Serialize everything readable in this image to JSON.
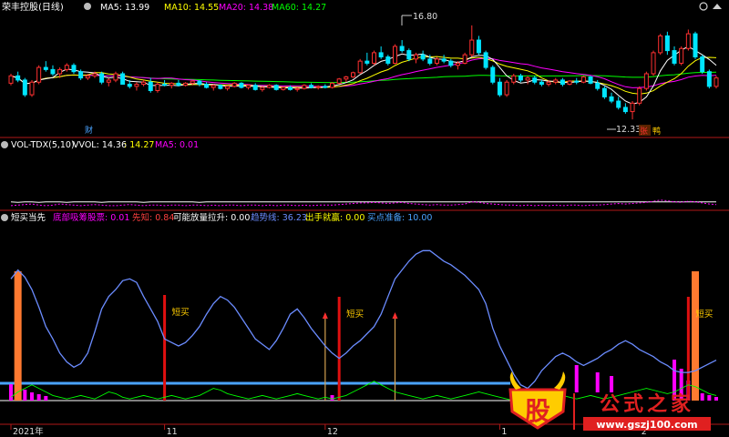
{
  "header": {
    "stock_title": "荣丰控股(日线)",
    "ma_items": [
      {
        "label": "MA5: 13.99",
        "color": "#ffffff"
      },
      {
        "label": "MA10: 14.55",
        "color": "#ffff00"
      },
      {
        "label": "MA20: 14.38",
        "color": "#ff00ff"
      },
      {
        "label": "MA60: 14.27",
        "color": "#00ff00"
      }
    ]
  },
  "price_annotations": {
    "high": "16.80",
    "low": "12.33",
    "cai_marker": "财",
    "zhang_marker": "张",
    "xiu_marker": "鸭"
  },
  "vol_header": {
    "title": "VOL-TDX(5,10)",
    "vvol": "VVOL: 14.36",
    "vvol2": ": 14.27",
    "ma5": "MA5: 0.01"
  },
  "ind_header": {
    "title": "短买当先",
    "items": [
      {
        "label": "底部吸筹股票: 0.01",
        "color": "#ff00ff"
      },
      {
        "label": "先知: 0.84",
        "color": "#ff4040"
      },
      {
        "label": "可能放量拉升: 0.00",
        "color": "#ffffff"
      },
      {
        "label": "趋势线: 36.23",
        "color": "#6b8cff"
      },
      {
        "label": "出手就赢: 0.00",
        "color": "#ffff00"
      },
      {
        "label": "买点准备: 10.00",
        "color": "#4aa3ff"
      }
    ]
  },
  "signal_label": "短买",
  "x_axis": {
    "labels": [
      {
        "text": "2021年",
        "i": 0
      },
      {
        "text": "11",
        "i": 22
      },
      {
        "text": "12",
        "i": 45
      },
      {
        "text": "1",
        "i": 70
      },
      {
        "text": "2",
        "i": 90
      }
    ]
  },
  "watermark": {
    "seal": "股",
    "name": "公式之家",
    "url": "www.gszj100.com"
  },
  "colors": {
    "up": "#ff3030",
    "down": "#00e5ff",
    "ma5": "#ffffff",
    "ma10": "#ffff00",
    "ma20": "#ff00ff",
    "ma60": "#00ff00",
    "trend": "#6b8cff"
  },
  "chart_data": [
    {
      "type": "candlestick",
      "name": "price",
      "ylim": [
        11.6,
        17.4
      ],
      "ohlc": [
        [
          14.05,
          14.5,
          13.95,
          14.4
        ],
        [
          14.4,
          14.6,
          14.1,
          14.2
        ],
        [
          14.2,
          14.3,
          13.4,
          13.5
        ],
        [
          13.5,
          14.2,
          13.4,
          14.1
        ],
        [
          14.1,
          14.9,
          14.0,
          14.8
        ],
        [
          14.8,
          15.1,
          14.6,
          14.7
        ],
        [
          14.7,
          14.9,
          14.4,
          14.5
        ],
        [
          14.5,
          14.8,
          14.3,
          14.7
        ],
        [
          14.7,
          15.0,
          14.6,
          14.9
        ],
        [
          14.9,
          15.0,
          14.5,
          14.6
        ],
        [
          14.6,
          14.7,
          14.2,
          14.3
        ],
        [
          14.3,
          14.5,
          14.2,
          14.4
        ],
        [
          14.4,
          14.6,
          14.3,
          14.5
        ],
        [
          14.5,
          14.6,
          14.0,
          14.1
        ],
        [
          14.1,
          14.3,
          13.9,
          14.2
        ],
        [
          14.2,
          14.6,
          14.1,
          14.5
        ],
        [
          14.5,
          14.6,
          14.0,
          14.0
        ],
        [
          14.0,
          14.2,
          13.8,
          13.9
        ],
        [
          13.9,
          14.1,
          13.7,
          14.0
        ],
        [
          14.0,
          14.2,
          13.9,
          14.1
        ],
        [
          14.1,
          14.3,
          13.6,
          13.7
        ],
        [
          13.7,
          14.1,
          13.6,
          14.0
        ],
        [
          14.0,
          14.2,
          13.9,
          13.95
        ],
        [
          13.95,
          14.1,
          13.8,
          14.05
        ],
        [
          14.05,
          14.2,
          13.9,
          13.95
        ],
        [
          13.95,
          14.1,
          13.9,
          14.05
        ],
        [
          14.05,
          14.2,
          13.95,
          14.15
        ],
        [
          14.15,
          14.2,
          13.9,
          14.0
        ],
        [
          14.0,
          14.1,
          13.8,
          13.85
        ],
        [
          13.85,
          14.0,
          13.7,
          13.95
        ],
        [
          13.95,
          14.0,
          13.75,
          13.8
        ],
        [
          13.8,
          13.95,
          13.7,
          13.9
        ],
        [
          13.9,
          14.1,
          13.85,
          14.05
        ],
        [
          14.05,
          14.1,
          13.8,
          13.85
        ],
        [
          13.85,
          14.0,
          13.75,
          13.95
        ],
        [
          13.95,
          14.05,
          13.7,
          13.75
        ],
        [
          13.75,
          13.9,
          13.65,
          13.85
        ],
        [
          13.85,
          14.0,
          13.8,
          13.95
        ],
        [
          13.95,
          14.0,
          13.7,
          13.75
        ],
        [
          13.75,
          13.9,
          13.7,
          13.85
        ],
        [
          13.85,
          13.95,
          13.7,
          13.75
        ],
        [
          13.75,
          13.85,
          13.65,
          13.8
        ],
        [
          13.8,
          14.0,
          13.75,
          13.95
        ],
        [
          13.95,
          14.05,
          13.8,
          13.85
        ],
        [
          13.85,
          13.95,
          13.75,
          13.9
        ],
        [
          13.9,
          14.0,
          13.8,
          13.85
        ],
        [
          13.85,
          14.1,
          13.8,
          14.05
        ],
        [
          14.05,
          14.3,
          14.0,
          14.25
        ],
        [
          14.25,
          14.4,
          14.1,
          14.35
        ],
        [
          14.35,
          14.6,
          14.3,
          14.55
        ],
        [
          14.55,
          15.2,
          14.5,
          15.1
        ],
        [
          15.1,
          15.5,
          14.9,
          15.0
        ],
        [
          15.0,
          15.6,
          14.9,
          15.5
        ],
        [
          15.5,
          15.8,
          15.2,
          15.3
        ],
        [
          15.3,
          15.4,
          14.9,
          15.0
        ],
        [
          15.0,
          15.9,
          14.95,
          15.8
        ],
        [
          15.8,
          16.1,
          15.5,
          15.6
        ],
        [
          15.6,
          15.7,
          15.1,
          15.2
        ],
        [
          15.2,
          15.5,
          15.0,
          15.4
        ],
        [
          15.4,
          15.6,
          15.1,
          15.2
        ],
        [
          15.2,
          15.4,
          14.9,
          15.0
        ],
        [
          15.0,
          15.3,
          14.9,
          15.2
        ],
        [
          15.2,
          15.4,
          15.0,
          15.1
        ],
        [
          15.1,
          15.2,
          14.8,
          14.9
        ],
        [
          14.9,
          15.1,
          14.7,
          15.0
        ],
        [
          15.0,
          15.5,
          14.95,
          15.4
        ],
        [
          15.4,
          16.8,
          15.3,
          16.1
        ],
        [
          16.1,
          16.3,
          15.4,
          15.5
        ],
        [
          15.5,
          15.6,
          14.7,
          14.8
        ],
        [
          14.8,
          14.9,
          14.0,
          14.1
        ],
        [
          14.1,
          14.3,
          13.4,
          13.5
        ],
        [
          13.5,
          14.2,
          13.4,
          14.1
        ],
        [
          14.1,
          14.5,
          14.0,
          14.4
        ],
        [
          14.4,
          14.5,
          14.1,
          14.2
        ],
        [
          14.2,
          14.4,
          14.0,
          14.3
        ],
        [
          14.3,
          14.4,
          14.0,
          14.1
        ],
        [
          14.1,
          14.2,
          13.9,
          14.0
        ],
        [
          14.0,
          14.2,
          13.9,
          14.1
        ],
        [
          14.1,
          14.3,
          14.0,
          14.2
        ],
        [
          14.2,
          14.3,
          13.9,
          14.0
        ],
        [
          14.0,
          14.2,
          13.95,
          14.15
        ],
        [
          14.15,
          14.3,
          14.0,
          14.1
        ],
        [
          14.1,
          14.4,
          14.05,
          14.35
        ],
        [
          14.35,
          14.4,
          14.0,
          14.05
        ],
        [
          14.05,
          14.2,
          13.7,
          13.8
        ],
        [
          13.8,
          13.9,
          13.3,
          13.4
        ],
        [
          13.4,
          13.6,
          13.1,
          13.2
        ],
        [
          13.2,
          13.4,
          12.8,
          12.9
        ],
        [
          12.9,
          13.1,
          12.6,
          12.7
        ],
        [
          12.7,
          13.2,
          12.33,
          13.1
        ],
        [
          13.1,
          13.9,
          13.0,
          13.8
        ],
        [
          13.8,
          14.6,
          13.7,
          14.5
        ],
        [
          14.5,
          15.6,
          14.4,
          15.5
        ],
        [
          15.5,
          16.4,
          15.4,
          16.3
        ],
        [
          16.3,
          16.5,
          15.4,
          15.6
        ],
        [
          15.6,
          15.8,
          14.9,
          15.0
        ],
        [
          15.0,
          15.8,
          14.9,
          15.7
        ],
        [
          15.7,
          16.6,
          15.6,
          16.4
        ],
        [
          16.4,
          16.5,
          15.2,
          15.3
        ],
        [
          15.3,
          15.4,
          14.5,
          14.6
        ],
        [
          14.6,
          14.7,
          13.8,
          13.9
        ],
        [
          13.9,
          14.4,
          13.8,
          14.3
        ]
      ]
    },
    {
      "type": "line",
      "name": "VOL-TDX",
      "ylim": [
        0,
        1
      ],
      "series": [
        {
          "name": "VVOL",
          "color": "#ffffff",
          "values": [
            0.12,
            0.11,
            0.12,
            0.12,
            0.11,
            0.12,
            0.12,
            0.12,
            0.11,
            0.12,
            0.12,
            0.12,
            0.12,
            0.11,
            0.12,
            0.12,
            0.12,
            0.12,
            0.12,
            0.11,
            0.12,
            0.12,
            0.12,
            0.12,
            0.12,
            0.12,
            0.12,
            0.11,
            0.12,
            0.12,
            0.12,
            0.12,
            0.12,
            0.12,
            0.12,
            0.12,
            0.12,
            0.12,
            0.12,
            0.12,
            0.12,
            0.12,
            0.12,
            0.12,
            0.12,
            0.12,
            0.12,
            0.12,
            0.12,
            0.12,
            0.12,
            0.12,
            0.12,
            0.12,
            0.12,
            0.12,
            0.12,
            0.12,
            0.12,
            0.12,
            0.12,
            0.12,
            0.12,
            0.12,
            0.12,
            0.12,
            0.12,
            0.12,
            0.12,
            0.12,
            0.12,
            0.12,
            0.12,
            0.12,
            0.12,
            0.12,
            0.12,
            0.12,
            0.12,
            0.12,
            0.12,
            0.12,
            0.12,
            0.12,
            0.12,
            0.12,
            0.12,
            0.12,
            0.12,
            0.12,
            0.12,
            0.12,
            0.12,
            0.12,
            0.12,
            0.12,
            0.12,
            0.12,
            0.12,
            0.12,
            0.12,
            0.12
          ]
        },
        {
          "name": "MA5",
          "color": "#ff00ff",
          "values": [
            0.05,
            0.06,
            0.07,
            0.08,
            0.06,
            0.05,
            0.06,
            0.08,
            0.07,
            0.06,
            0.05,
            0.06,
            0.07,
            0.06,
            0.05,
            0.05,
            0.06,
            0.07,
            0.06,
            0.05,
            0.06,
            0.06,
            0.05,
            0.06,
            0.06,
            0.05,
            0.06,
            0.06,
            0.05,
            0.06,
            0.05,
            0.06,
            0.06,
            0.05,
            0.06,
            0.06,
            0.05,
            0.06,
            0.05,
            0.06,
            0.06,
            0.05,
            0.06,
            0.05,
            0.06,
            0.06,
            0.06,
            0.07,
            0.08,
            0.09,
            0.1,
            0.1,
            0.11,
            0.1,
            0.09,
            0.1,
            0.11,
            0.09,
            0.08,
            0.07,
            0.06,
            0.07,
            0.06,
            0.06,
            0.07,
            0.08,
            0.12,
            0.11,
            0.09,
            0.08,
            0.07,
            0.06,
            0.06,
            0.05,
            0.06,
            0.05,
            0.06,
            0.05,
            0.06,
            0.05,
            0.06,
            0.06,
            0.05,
            0.06,
            0.06,
            0.07,
            0.08,
            0.09,
            0.08,
            0.09,
            0.1,
            0.11,
            0.13,
            0.15,
            0.14,
            0.12,
            0.11,
            0.13,
            0.12,
            0.1,
            0.08,
            0.07
          ]
        }
      ]
    },
    {
      "type": "line",
      "name": "短买当先",
      "ylim": [
        0,
        100
      ],
      "series": [
        {
          "name": "趋势线",
          "color": "#6b8cff",
          "values": [
            72,
            77,
            73,
            66,
            56,
            45,
            38,
            30,
            25,
            22,
            24,
            30,
            42,
            55,
            62,
            66,
            71,
            72,
            70,
            62,
            55,
            48,
            38,
            36,
            34,
            36,
            40,
            45,
            52,
            58,
            62,
            60,
            56,
            50,
            44,
            38,
            35,
            32,
            37,
            44,
            52,
            55,
            50,
            44,
            39,
            34,
            30,
            27,
            30,
            34,
            37,
            41,
            45,
            52,
            62,
            72,
            77,
            82,
            86,
            88,
            88,
            85,
            82,
            80,
            77,
            74,
            70,
            66,
            58,
            44,
            34,
            26,
            18,
            12,
            10,
            14,
            20,
            24,
            28,
            30,
            28,
            25,
            23,
            25,
            27,
            30,
            32,
            35,
            37,
            35,
            32,
            30,
            28,
            25,
            23,
            20,
            19,
            19,
            20,
            22,
            24,
            26
          ]
        },
        {
          "name": "出手就赢",
          "color": "#00ff00",
          "values": [
            5,
            8,
            10,
            12,
            10,
            8,
            6,
            5,
            4,
            5,
            6,
            5,
            4,
            6,
            8,
            7,
            5,
            4,
            5,
            6,
            5,
            4,
            5,
            6,
            5,
            4,
            5,
            6,
            8,
            10,
            9,
            7,
            6,
            5,
            4,
            5,
            6,
            5,
            4,
            5,
            6,
            7,
            6,
            5,
            4,
            5,
            4,
            5,
            6,
            8,
            10,
            12,
            14,
            12,
            10,
            8,
            7,
            6,
            5,
            4,
            5,
            6,
            5,
            4,
            5,
            6,
            7,
            8,
            7,
            6,
            5,
            4,
            3,
            4,
            5,
            6,
            5,
            4,
            5,
            6,
            5,
            4,
            5,
            6,
            5,
            4,
            5,
            6,
            7,
            8,
            9,
            10,
            9,
            8,
            7,
            8,
            10,
            12,
            11,
            9,
            7,
            6
          ]
        }
      ],
      "signal_bars_index": [
        22,
        47,
        97
      ]
    }
  ]
}
